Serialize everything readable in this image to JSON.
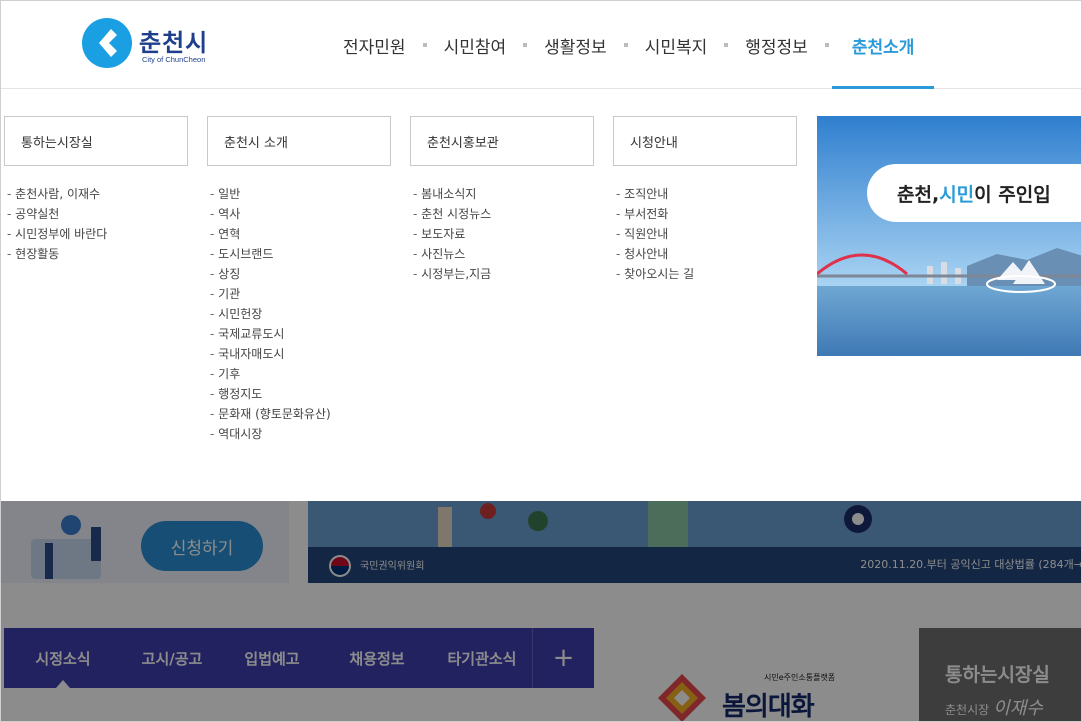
{
  "header": {
    "logo_name": "춘천시",
    "logo_sub": "City of ChunCheon",
    "nav": [
      "전자민원",
      "시민참여",
      "생활정보",
      "시민복지",
      "행정정보",
      "춘천소개"
    ],
    "active_nav": "춘천소개"
  },
  "mega_menu": {
    "columns": [
      {
        "title": "통하는시장실",
        "items": [
          "춘천사람, 이재수",
          "공약실천",
          "시민정부에 바란다",
          "현장활동"
        ]
      },
      {
        "title": "춘천시 소개",
        "items": [
          "일반",
          "역사",
          "연혁",
          "도시브랜드",
          "상징",
          "기관",
          "시민헌장",
          "국제교류도시",
          "국내자매도시",
          "기후",
          "행정지도",
          "문화재 (향토문화유산)",
          "역대시장"
        ]
      },
      {
        "title": "춘천시홍보관",
        "items": [
          "봄내소식지",
          "춘천 시정뉴스",
          "보도자료",
          "사진뉴스",
          "시정부는,지금"
        ]
      },
      {
        "title": "시청안내",
        "items": [
          "조직안내",
          "부서전화",
          "직원안내",
          "청사안내",
          "찾아오시는 길"
        ]
      }
    ],
    "banner": {
      "caption_a": "춘천, ",
      "caption_hl": "시민",
      "caption_b": "이 주인입"
    }
  },
  "background": {
    "apply_button": "신청하기",
    "campaign_org": "국민권익위원회",
    "campaign_note": "2020.11.20.부터 공익신고 대상법률 (284개→",
    "tabs": [
      "시정소식",
      "고시/공고",
      "입법예고",
      "채용정보",
      "타기관소식"
    ],
    "tabs_more": "+",
    "dialogue_tag": "시민e주인소통플랫폼",
    "dialogue_title": "봄의대화",
    "mayor_title": "통하는시장실",
    "mayor_role": "춘천시장",
    "mayor_name": "이재수"
  },
  "colors": {
    "accent": "#2a9bd8",
    "brand_navy": "#1d3f8c",
    "tab_bar": "#3f3fb0"
  }
}
